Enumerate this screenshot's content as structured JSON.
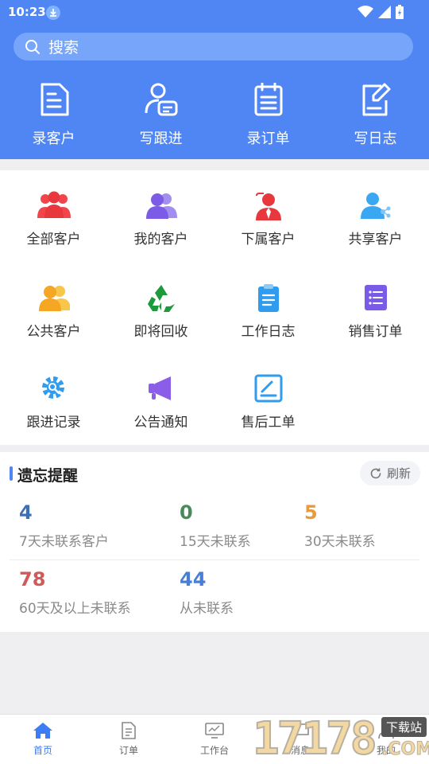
{
  "status": {
    "time": "10:23"
  },
  "search": {
    "placeholder": "搜索"
  },
  "quick_actions": [
    {
      "label": "录客户",
      "icon": "document-icon"
    },
    {
      "label": "写跟进",
      "icon": "user-note-icon"
    },
    {
      "label": "录订单",
      "icon": "calendar-list-icon"
    },
    {
      "label": "写日志",
      "icon": "edit-document-icon"
    }
  ],
  "grid": [
    {
      "label": "全部客户",
      "icon": "group-icon",
      "color": "#f0454b"
    },
    {
      "label": "我的客户",
      "icon": "users-icon",
      "color": "#7c5ce6"
    },
    {
      "label": "下属客户",
      "icon": "subordinate-icon",
      "color": "#e8383d"
    },
    {
      "label": "共享客户",
      "icon": "share-user-icon",
      "color": "#3aa7f3"
    },
    {
      "label": "公共客户",
      "icon": "public-users-icon",
      "color": "#f5b420"
    },
    {
      "label": "即将回收",
      "icon": "recycle-icon",
      "color": "#1c9a3c"
    },
    {
      "label": "工作日志",
      "icon": "clipboard-icon",
      "color": "#2f9cf0"
    },
    {
      "label": "销售订单",
      "icon": "order-list-icon",
      "color": "#7a5be8"
    },
    {
      "label": "跟进记录",
      "icon": "gear-search-icon",
      "color": "#2f9cf0"
    },
    {
      "label": "公告通知",
      "icon": "megaphone-icon",
      "color": "#8a5ee9"
    },
    {
      "label": "售后工单",
      "icon": "work-order-icon",
      "color": "#2f9cf0"
    }
  ],
  "reminder": {
    "title": "遗忘提醒",
    "refresh_label": "刷新",
    "items": [
      {
        "value": "4",
        "label": "7天未联系客户",
        "color": "#3d6fb6"
      },
      {
        "value": "0",
        "label": "15天未联系",
        "color": "#4a8a5a"
      },
      {
        "value": "5",
        "label": "30天未联系",
        "color": "#e99a3c"
      },
      {
        "value": "78",
        "label": "60天及以上未联系",
        "color": "#d0595a"
      },
      {
        "value": "44",
        "label": "从未联系",
        "color": "#4a7ed6"
      }
    ]
  },
  "nav": [
    {
      "label": "首页",
      "icon": "home-icon",
      "active": true
    },
    {
      "label": "订单",
      "icon": "order-icon",
      "active": false
    },
    {
      "label": "工作台",
      "icon": "workbench-icon",
      "active": false
    },
    {
      "label": "消息",
      "icon": "message-icon",
      "active": false
    },
    {
      "label": "我的",
      "icon": "profile-icon",
      "active": false
    }
  ],
  "watermark": {
    "digits": "17178",
    "badge": "下载站",
    "suffix": ".COM"
  },
  "colors": {
    "primary": "#4f86f3",
    "search_bg": "#77a5fa",
    "active_nav": "#3d7cf5"
  }
}
